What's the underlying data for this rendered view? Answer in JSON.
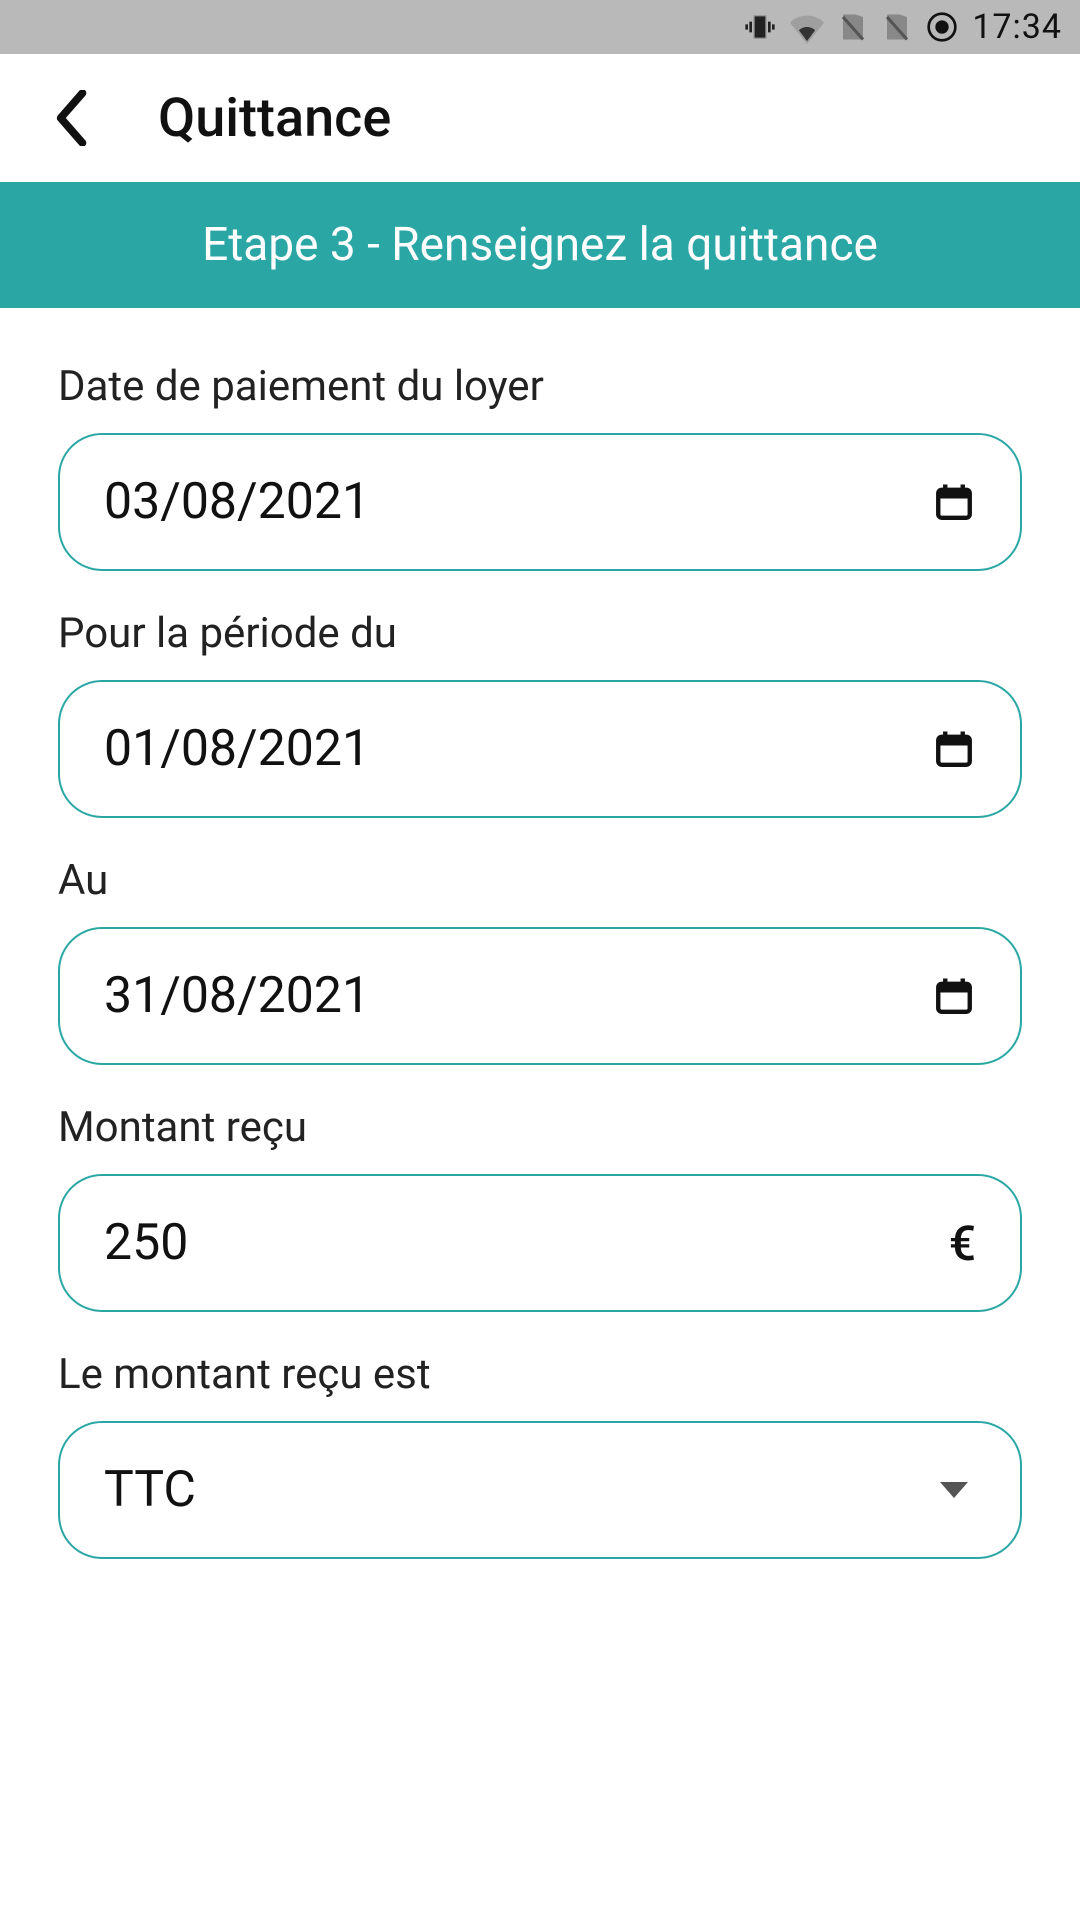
{
  "status": {
    "time": "17:34"
  },
  "header": {
    "title": "Quittance"
  },
  "banner": {
    "step": "Etape 3 - Renseignez la quittance"
  },
  "form": {
    "payment_date": {
      "label": "Date de paiement du loyer",
      "value": "03/08/2021"
    },
    "period_from": {
      "label": "Pour la période du",
      "value": "01/08/2021"
    },
    "period_to": {
      "label": "Au",
      "value": "31/08/2021"
    },
    "amount": {
      "label": "Montant reçu",
      "value": "250",
      "currency": "€"
    },
    "amount_type": {
      "label": "Le montant reçu est",
      "value": "TTC"
    }
  }
}
